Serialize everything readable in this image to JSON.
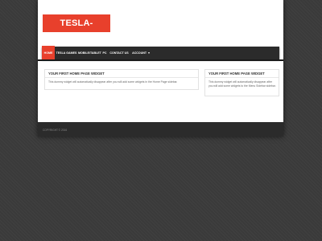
{
  "site": {
    "logo_text": "TESLA-PLAY.COM"
  },
  "nav": {
    "items": [
      {
        "label": "HOME"
      },
      {
        "label": "TESLA GAMES"
      },
      {
        "label": "MOBILE/TABLET"
      },
      {
        "label": "PC"
      },
      {
        "label": "CONTACT US"
      },
      {
        "label": "ACCOUNT"
      }
    ],
    "dropdown_glyph": "▾"
  },
  "widgets": [
    {
      "title": "YOUR FIRST HOME PAGE WIDGET",
      "body": "This dummy widget will automatically disappear after you will add some widgets in the Home Page sidebar."
    },
    {
      "title": "YOUR FIRST HOME PAGE WIDGET",
      "body": "This dummy widget will automatically disappear after you will add some widgets to the Menu Sidebar sidebar."
    }
  ],
  "footer": {
    "copyright": "COPYRIGHT © 2016"
  },
  "colors": {
    "accent": "#e8402c",
    "nav_bg": "#2b2b2b",
    "page_bg": "#3a3a3a"
  }
}
